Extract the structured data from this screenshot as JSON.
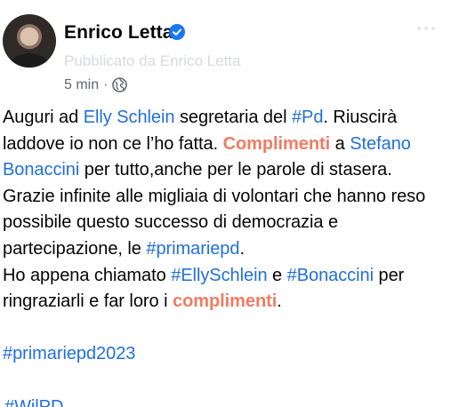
{
  "post": {
    "author": "Enrico Letta",
    "published_by": "Pubblicato da Enrico Letta",
    "time": "5 min",
    "separator": "·",
    "audience_icon": "globe-icon",
    "verified_icon": "verified-badge-icon",
    "more_icon": "more-options-icon"
  },
  "text": {
    "s1": "Auguri ad ",
    "l1": "Elly Schlein",
    "s2": " segretaria del ",
    "l2": "#Pd",
    "s3": ". Riuscirà laddove io non ce l’ho fatta. ",
    "a1": "Complimenti",
    "s4": " a ",
    "l3": "Stefano Bonaccini",
    "s5": " per tutto,anche per le parole di stasera. Grazie infinite alle migliaia di volontari che hanno reso possibile questo successo di democrazia e partecipazione, le ",
    "l4": "#primariepd",
    "s6": ".",
    "s7": "Ho appena chiamato ",
    "l5": "#EllySchlein",
    "s8": " e ",
    "l6": "#Bonaccini",
    "s9": " per ringraziarli e far loro i ",
    "a2": "complimenti",
    "s10": ".",
    "tag1": "#primariepd2023",
    "tag2": "#WilPD"
  },
  "colors": {
    "link": "#216fdb",
    "accent": "#f07c63",
    "meta": "#65676b",
    "verified": "#1877f2"
  }
}
